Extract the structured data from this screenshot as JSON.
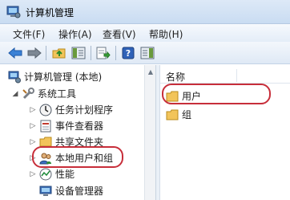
{
  "window": {
    "title": "计算机管理"
  },
  "menu": [
    {
      "label": "文件(F)"
    },
    {
      "label": "操作(A)"
    },
    {
      "label": "查看(V)"
    },
    {
      "label": "帮助(H)"
    }
  ],
  "tree": {
    "root": "计算机管理 (本地)",
    "system_tools": "系统工具",
    "items": [
      {
        "label": "任务计划程序"
      },
      {
        "label": "事件查看器"
      },
      {
        "label": "共享文件夹"
      },
      {
        "label": "本地用户和组"
      },
      {
        "label": "性能"
      },
      {
        "label": "设备管理器"
      }
    ]
  },
  "list": {
    "column": "名称",
    "items": [
      {
        "label": "用户"
      },
      {
        "label": "组"
      }
    ]
  },
  "colors": {
    "highlight_ring": "#c72e3a",
    "folder": "#f2c45a"
  }
}
